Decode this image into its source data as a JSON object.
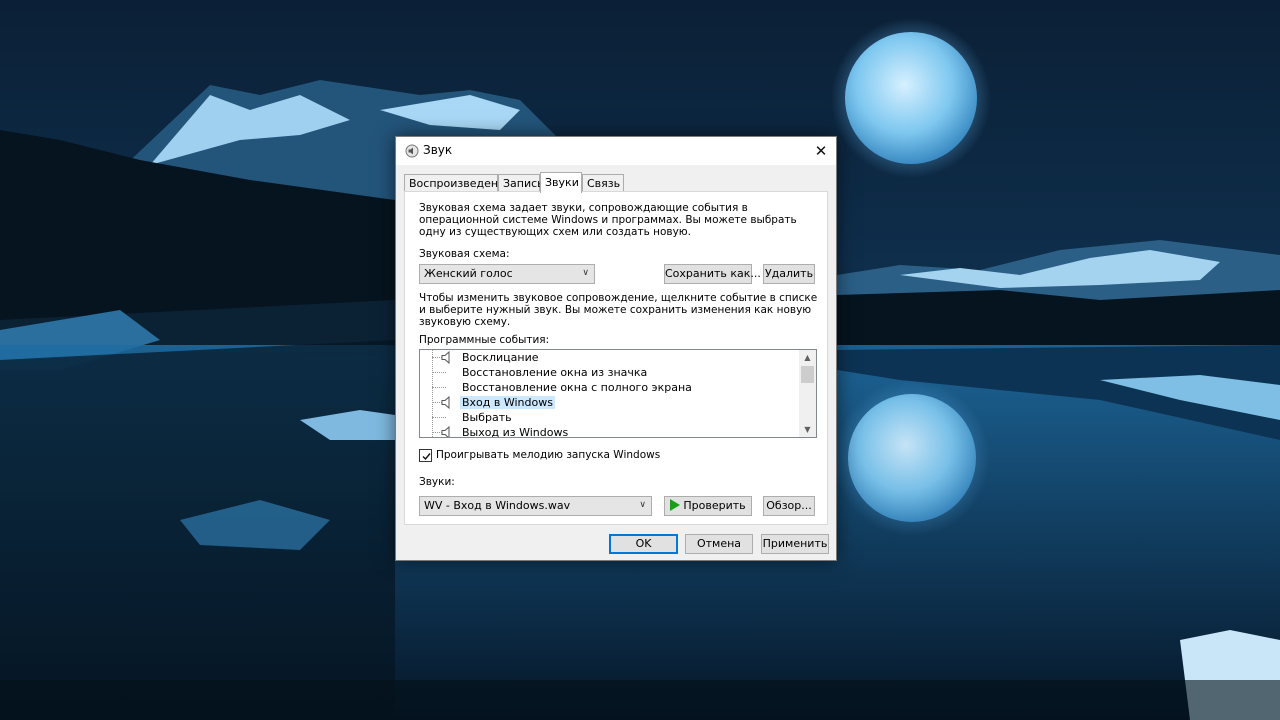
{
  "window": {
    "title": "Звук",
    "close_glyph": "✕"
  },
  "tabs": [
    {
      "label": "Воспроизведение"
    },
    {
      "label": "Запись"
    },
    {
      "label": "Звуки"
    },
    {
      "label": "Связь"
    }
  ],
  "panel": {
    "scheme_description": "Звуковая схема задает звуки, сопровождающие события в операционной системе Windows и программах. Вы можете выбрать одну из существующих схем или создать новую.",
    "scheme_label": "Звуковая схема:",
    "scheme_value": "Женский голос",
    "save_as_label": "Сохранить как...",
    "delete_label": "Удалить",
    "change_description": "Чтобы изменить звуковое сопровождение, щелкните событие в списке и выберите нужный звук. Вы можете сохранить изменения как новую звуковую схему.",
    "events_label": "Программные события:",
    "events": [
      {
        "label": "Восклицание",
        "has_sound": true,
        "selected": false
      },
      {
        "label": "Восстановление окна из значка",
        "has_sound": false,
        "selected": false
      },
      {
        "label": "Восстановление окна с полного экрана",
        "has_sound": false,
        "selected": false
      },
      {
        "label": "Вход в Windows",
        "has_sound": true,
        "selected": true
      },
      {
        "label": "Выбрать",
        "has_sound": false,
        "selected": false
      },
      {
        "label": "Выход из Windows",
        "has_sound": true,
        "selected": false
      }
    ],
    "startup_checkbox_label": "Проигрывать мелодию запуска Windows",
    "startup_checked": true,
    "sounds_label": "Звуки:",
    "sound_file": "WV - Вход в Windows.wav",
    "test_label": "Проверить",
    "browse_label": "Обзор..."
  },
  "footer": {
    "ok_label": "OK",
    "cancel_label": "Отмена",
    "apply_label": "Применить"
  },
  "colors": {
    "selection": "#cce8ff",
    "accent": "#0078d7",
    "play_icon": "#1a9e1a"
  }
}
